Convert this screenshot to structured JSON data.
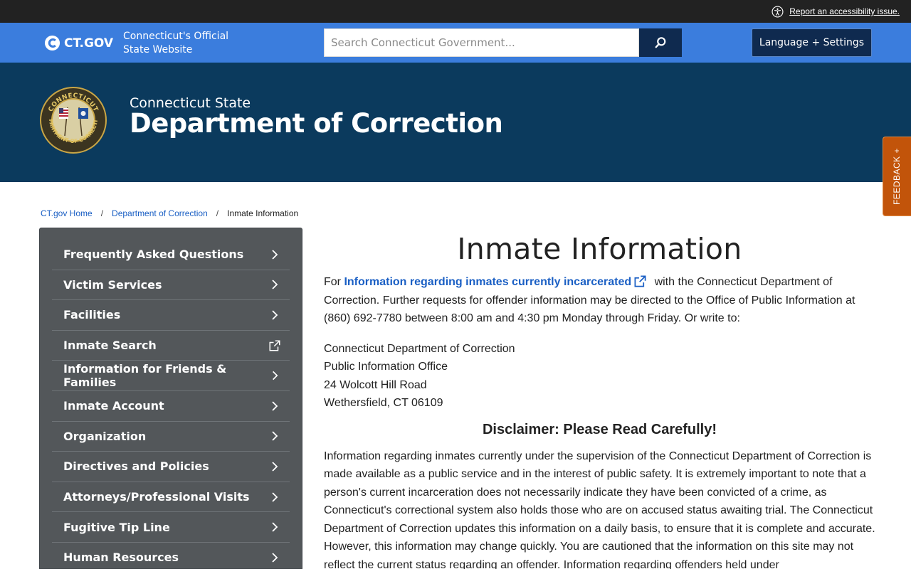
{
  "utility_bar": {
    "accessibility_link": "Report an accessibility issue."
  },
  "header": {
    "logo_text": "CT.GOV",
    "tagline": "Connecticut's Official State Website",
    "search_placeholder": "Search Connecticut Government...",
    "language_button": "Language + Settings"
  },
  "agency": {
    "prefix": "Connecticut State",
    "name": "Department of Correction",
    "seal_text_top": "CONNECTICUT",
    "seal_text_bottom": "DEPARTMENT OF CORRECTION"
  },
  "feedback": {
    "label": "FEEDBACK +"
  },
  "breadcrumb": {
    "home": "CT.gov Home",
    "sep": "/",
    "department": "Department of Correction",
    "current": "Inmate Information"
  },
  "sidebar": {
    "items": [
      {
        "label": "Frequently Asked Questions",
        "icon": "chevron-right"
      },
      {
        "label": "Victim Services",
        "icon": "chevron-right"
      },
      {
        "label": "Facilities",
        "icon": "chevron-right"
      },
      {
        "label": "Inmate Search",
        "icon": "external-link"
      },
      {
        "label": "Information for Friends & Families",
        "icon": "chevron-right"
      },
      {
        "label": "Inmate Account",
        "icon": "chevron-right"
      },
      {
        "label": "Organization",
        "icon": "chevron-right"
      },
      {
        "label": "Directives and Policies",
        "icon": "chevron-right"
      },
      {
        "label": "Attorneys/Professional Visits",
        "icon": "chevron-right"
      },
      {
        "label": "Fugitive Tip Line",
        "icon": "chevron-right"
      },
      {
        "label": "Human Resources",
        "icon": "chevron-right"
      }
    ]
  },
  "main": {
    "title": "Inmate Information",
    "intro_prefix": "For ",
    "intro_link": "Information regarding inmates currently incarcerated",
    "intro_rest": " with the Connecticut Department of Correction. Further requests for offender information may be directed to the Office of Public Information at (860) 692-7780 between 8:00 am and 4:30 pm Monday through Friday.  Or write to:",
    "address": [
      "Connecticut Department of Correction",
      "Public Information Office",
      "24 Wolcott Hill Road",
      "Wethersfield, CT 06109"
    ],
    "disclaimer_title": "Disclaimer: Please Read Carefully!",
    "disclaimer_body": "Information regarding inmates currently under the supervision of the Connecticut Department of Correction is made available as a public service and in the interest of public safety. It is extremely important to note that a person's current incarceration does not necessarily indicate they have been convicted of a crime, as Connecticut's correctional system also holds those who are on accused status awaiting trial. The Connecticut Department of Correction updates this information on a daily basis, to ensure that it is complete and accurate. However, this information may change quickly. You are cautioned that the information on this site may not reflect the current status regarding an offender. Information regarding offenders held under"
  },
  "colors": {
    "utility_bar": "#222222",
    "header_blue": "#3b7ddd",
    "navy": "#0f2a4f",
    "banner": "#0b3a5d",
    "sidebar": "#53575a",
    "link": "#1a5fc4",
    "feedback": "#c2540a"
  }
}
